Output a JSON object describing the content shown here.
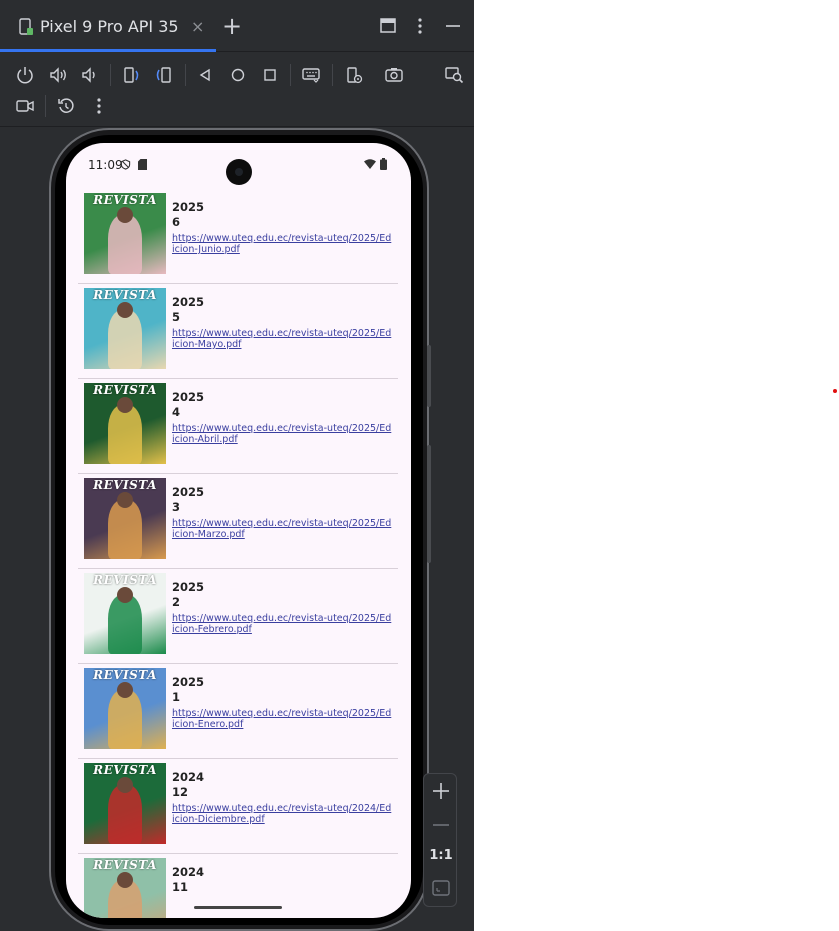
{
  "tab": {
    "title": "Pixel 9 Pro API 35",
    "close_glyph": "×",
    "add_glyph": "+"
  },
  "window_controls": [
    "restore-icon",
    "more-vert-icon",
    "minimize-icon"
  ],
  "toolbar": {
    "row1": [
      "power-icon",
      "volume-up-icon",
      "volume-down-icon",
      "rotate-left-icon",
      "rotate-right-icon",
      "back-icon",
      "home-icon",
      "overview-icon",
      "keyboard-icon",
      "device-settings-icon",
      "screenshot-icon",
      "screen-zoom-icon"
    ],
    "row2": [
      "screen-record-icon",
      "reset-icon",
      "more-vert-icon"
    ]
  },
  "phone": {
    "status_time": "11:09",
    "status_icons": [
      "do-not-disturb-icon",
      "sd-card-icon",
      "wifi-icon",
      "battery-icon"
    ],
    "items": [
      {
        "year": "2025",
        "num": "6",
        "url": "https://www.uteq.edu.ec/revista-uteq/2025/Edicion-Junio.pdf",
        "thumb_title": "REVISTA",
        "thumb_bg": "#3a8b4a",
        "thumb_accent": "#e8b9c0"
      },
      {
        "year": "2025",
        "num": "5",
        "url": "https://www.uteq.edu.ec/revista-uteq/2025/Edicion-Mayo.pdf",
        "thumb_title": "REVISTA",
        "thumb_bg": "#4fb4c8",
        "thumb_accent": "#e9d7b0"
      },
      {
        "year": "2025",
        "num": "4",
        "url": "https://www.uteq.edu.ec/revista-uteq/2025/Edicion-Abril.pdf",
        "thumb_title": "REVISTA",
        "thumb_bg": "#1e5a2e",
        "thumb_accent": "#e3c04a"
      },
      {
        "year": "2025",
        "num": "3",
        "url": "https://www.uteq.edu.ec/revista-uteq/2025/Edicion-Marzo.pdf",
        "thumb_title": "REVISTA",
        "thumb_bg": "#4a3a52",
        "thumb_accent": "#d89a4e"
      },
      {
        "year": "2025",
        "num": "2",
        "url": "https://www.uteq.edu.ec/revista-uteq/2025/Edicion-Febrero.pdf",
        "thumb_title": "REVISTA",
        "thumb_bg": "#eef3f0",
        "thumb_accent": "#1a8a4a"
      },
      {
        "year": "2025",
        "num": "1",
        "url": "https://www.uteq.edu.ec/revista-uteq/2025/Edicion-Enero.pdf",
        "thumb_title": "REVISTA",
        "thumb_bg": "#5a8fd0",
        "thumb_accent": "#e0b050"
      },
      {
        "year": "2024",
        "num": "12",
        "url": "https://www.uteq.edu.ec/revista-uteq/2024/Edicion-Diciembre.pdf",
        "thumb_title": "REVISTA",
        "thumb_bg": "#1c6b3a",
        "thumb_accent": "#c22a2a"
      },
      {
        "year": "2024",
        "num": "11",
        "url": "",
        "thumb_title": "REVISTA",
        "thumb_bg": "#8fc0a8",
        "thumb_accent": "#d8a070"
      }
    ]
  },
  "zoom": {
    "fit_label": "1:1"
  },
  "colors": {
    "ide_bg": "#2b2d30",
    "tab_accent": "#3574f0",
    "screen_bg": "#fdf6fd",
    "link": "#3a3fa0"
  }
}
